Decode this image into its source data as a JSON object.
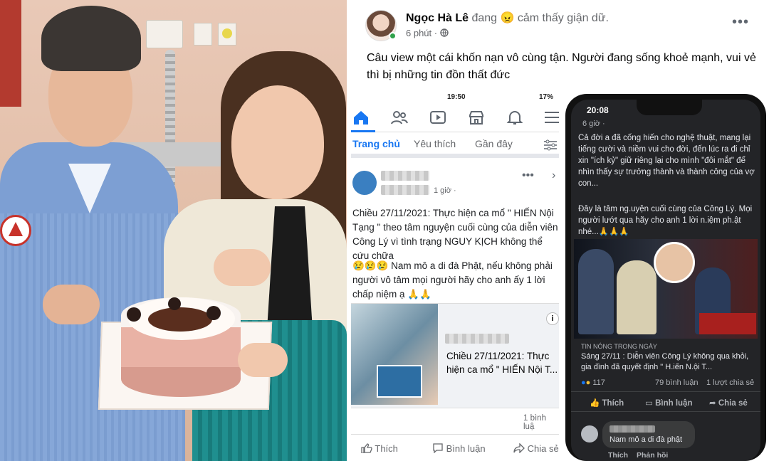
{
  "post": {
    "author": "Ngọc Hà Lê",
    "feeling": "đang 😠 cảm thấy giận dữ.",
    "time": "6 phút ·",
    "caption": "Câu view một cái khốn nạn vô cùng tận. Người đang sống khoẻ mạnh, vui vẻ thì bị những tin đồn thất đức"
  },
  "shot1": {
    "status_time": "19:50",
    "battery": "17%",
    "tabs": [
      "Trang chủ",
      "Yêu thích",
      "Gần đây"
    ],
    "post_time": "1 giờ ·",
    "body": "Chiều 27/11/2021: Thực hiện ca mổ \" HIẾN Nội Tạng \" theo tâm nguyện cuối cùng của diễn viên Công Lý vì tình trạng NGUY KỊCH không thể cứu chữa",
    "body2": "😢😢😢 Nam mô a di đà Phật, nếu không phải người vô tâm mọi người hãy cho anh ấy 1 lời chấp niệm ạ 🙏🙏",
    "link_title": "Chiều 27/11/2021: Thực hiện ca mổ \" HIẾN Nội T...",
    "comments": "1 bình luậ",
    "actions": [
      "Thích",
      "Bình luận",
      "Chia sẻ"
    ]
  },
  "shot2": {
    "status_time": "20:08",
    "time_fragment": "6 giờ ·",
    "body": "Cả đời a đã cống hiến cho nghệ thuật, mang lại tiếng cười và niềm vui cho đời, đến lúc ra đi chỉ xin \"ích kỷ\" giữ riêng lại cho mình \"đôi mắt\" để nhìn thấy sự trưởng thành và thành công của vợ con...",
    "body2": "Đây là tâm ng.uyện cuối cùng của Công Lý. Mọi người lướt qua hãy cho anh 1 lời n.iệm ph.ật nhé...🙏🙏🙏",
    "news_label": "TIN NÓNG TRONG NGÀY",
    "news_title": "Sáng 27/11 : Diễn viên Công Lý không qua khỏi, gia đình đã quyết định \" H.iến N.ội T...",
    "reactions": "117",
    "comments": "79 bình luận",
    "shares": "1 lượt chia sẻ",
    "actions": [
      "Thích",
      "Bình luận",
      "Chia sẻ"
    ],
    "comment_text": "Nam mô a di đà phật",
    "comment_actions": [
      "Thích",
      "Phản hồi"
    ]
  }
}
